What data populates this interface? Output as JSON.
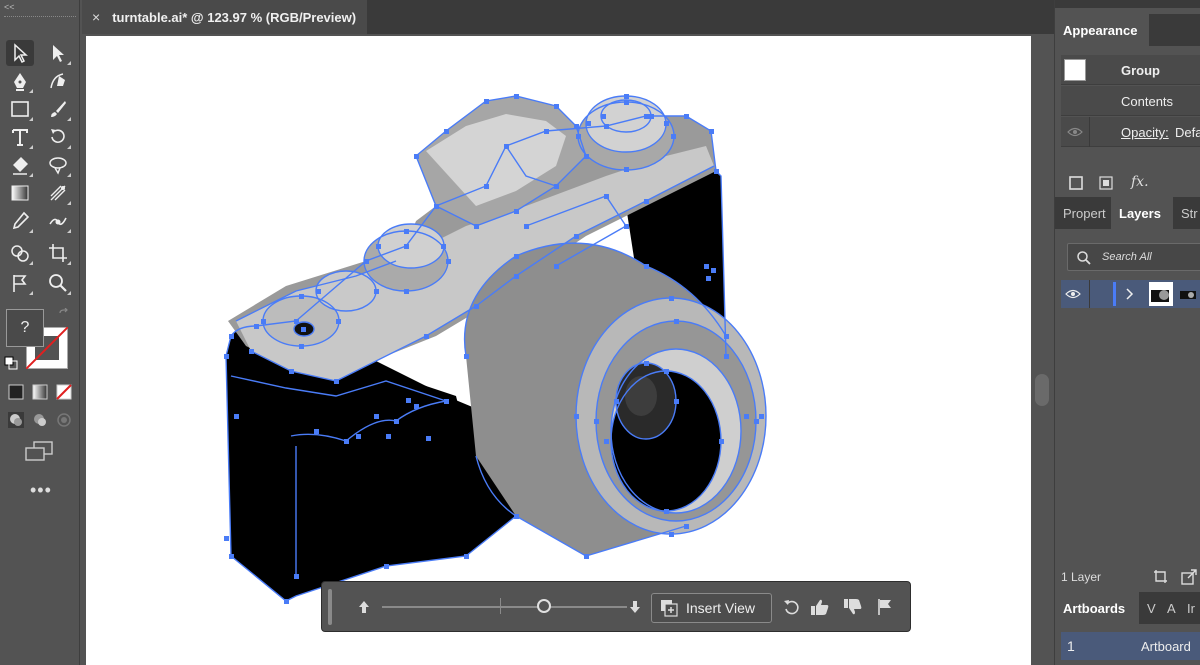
{
  "document_tab": {
    "close_glyph": "×",
    "title": "turntable.ai* @ 123.97 % (RGB/Preview)"
  },
  "toolbar": {
    "grip_glyph": "<<",
    "fill_unknown": "?",
    "more_glyph": "•••",
    "tools": [
      "selection-tool",
      "direct-selection-tool",
      "pen-tool",
      "curvature-tool",
      "rectangle-tool",
      "paintbrush-tool",
      "type-tool",
      "rotate-tool",
      "eraser-tool",
      "width-tool",
      "gradient-tool",
      "eyedropper-tool",
      "eyedropper-tool-2",
      "puppet-warp-tool",
      "shape-builder-tool",
      "artboard-tool",
      "flag-tool",
      "zoom-tool"
    ]
  },
  "turntable_bar": {
    "insert_view_label": "Insert View",
    "slider_value_fraction": 0.66
  },
  "appearance_panel": {
    "tab": "Appearance",
    "object_type": "Group",
    "contents_label": "Contents",
    "opacity_label": "Opacity:",
    "opacity_value": "Defa",
    "fx_label": "fx."
  },
  "layers_panel": {
    "tabs": [
      "Propert",
      "Layers",
      "Str"
    ],
    "active_tab": "Layers",
    "search_placeholder": "Search All",
    "layer_count": "1 Layer"
  },
  "artboards_panel": {
    "tabs": [
      "Artboards",
      "V",
      "A",
      "Ir"
    ],
    "rows": [
      {
        "number": "1",
        "name": "Artboard"
      }
    ]
  },
  "colors": {
    "selection_blue": "#4a7cf7",
    "panel_bg": "#535353",
    "selected_row": "#4a5a7a"
  }
}
